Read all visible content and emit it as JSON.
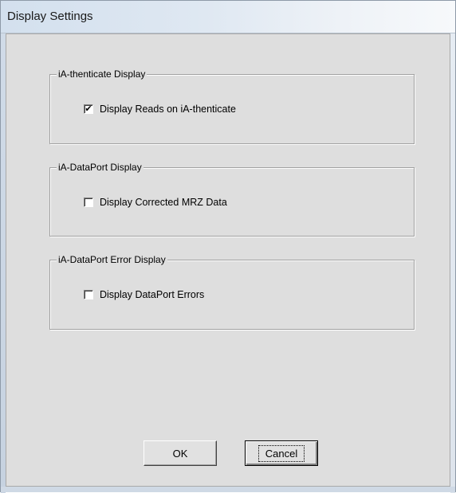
{
  "window": {
    "title": "Display Settings"
  },
  "groups": [
    {
      "legend": "iA-thenticate Display",
      "checkbox_label": "Display Reads on iA-thenticate",
      "checked": true,
      "check_glyph": "✔"
    },
    {
      "legend": "iA-DataPort Display",
      "checkbox_label": "Display Corrected MRZ Data",
      "checked": false,
      "check_glyph": ""
    },
    {
      "legend": "iA-DataPort Error Display",
      "checkbox_label": "Display DataPort Errors",
      "checked": false,
      "check_glyph": ""
    }
  ],
  "buttons": {
    "ok_label": "OK",
    "cancel_label": "Cancel"
  }
}
